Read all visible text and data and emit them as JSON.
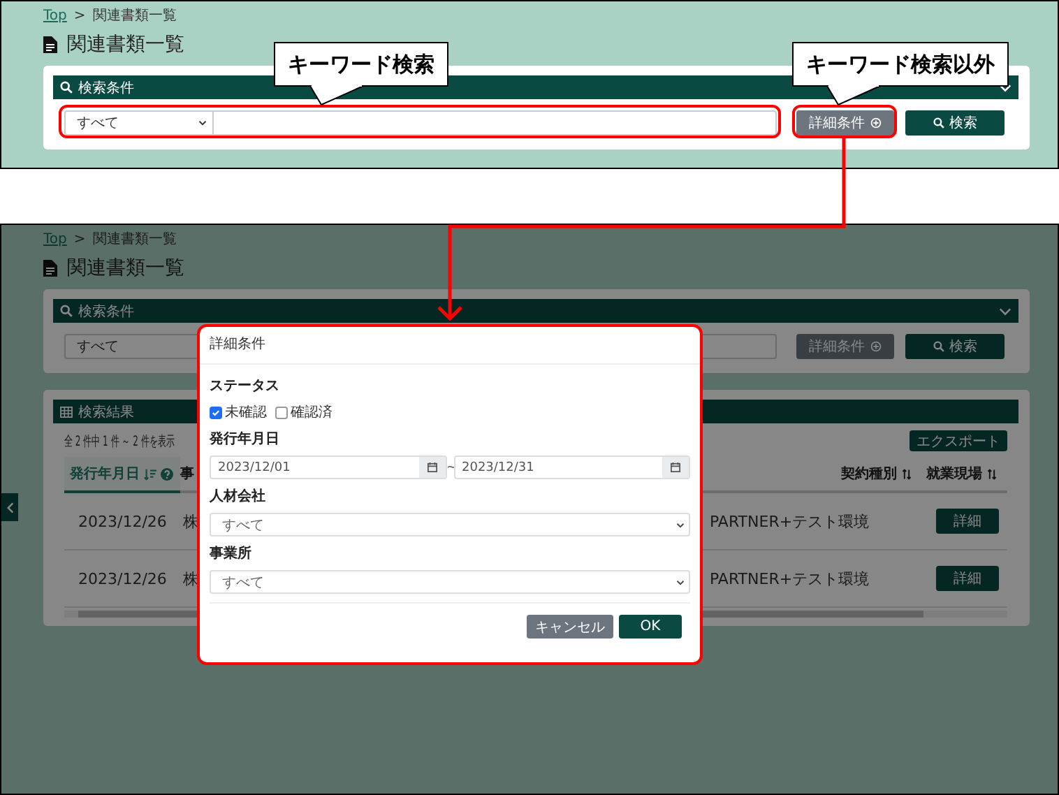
{
  "callouts": [
    {
      "text": "キーワード検索"
    },
    {
      "text": "キーワード検索以外"
    }
  ],
  "screens": [
    {
      "kind": "before",
      "breadcrumb": [
        "Top",
        "関連書類一覧"
      ],
      "breadcrumb_separator": ">",
      "title": "関連書類一覧",
      "search_panel": {
        "title": "検索条件",
        "select_value": "すべて",
        "detail_button": "詳細条件",
        "search_button": "検索"
      }
    },
    {
      "kind": "after",
      "breadcrumb": [
        "Top",
        "関連書類一覧"
      ],
      "breadcrumb_separator": ">",
      "title": "関連書類一覧",
      "search_panel": {
        "title": "検索条件",
        "select_value": "すべて",
        "detail_button": "詳細条件",
        "search_button": "検索"
      },
      "results": {
        "title": "検索結果",
        "count": "全 2 件中 1 件 ～ 2 件を表示",
        "export_button": "エクスポート",
        "columns": [
          {
            "label": "発行年月日",
            "sorted": true,
            "help": true
          },
          {
            "label": "事"
          },
          {
            "label": "契約種別",
            "sorted": false
          },
          {
            "label": "就業現場",
            "sorted": false
          }
        ],
        "rows": [
          {
            "date": "2023/12/26",
            "company": "株",
            "client": "PARTNER+テスト環境",
            "button": "詳細"
          },
          {
            "date": "2023/12/26",
            "company": "株",
            "client": "PARTNER+テスト環境",
            "button": "詳細"
          }
        ]
      }
    }
  ],
  "modal": {
    "title": "詳細条件",
    "status_label": "ステータス",
    "checkboxes": [
      {
        "label": "未確認",
        "checked": true
      },
      {
        "label": "確認済",
        "checked": false
      }
    ],
    "date_label": "発行年月日",
    "date_from": "2023/12/01",
    "separator": "~",
    "date_to": "2023/12/31",
    "company_label": "人材会社",
    "company_value": "すべて",
    "office_label": "事業所",
    "office_value": "すべて",
    "buttons": [
      {
        "label": "キャンセル",
        "kind": "secondary"
      },
      {
        "label": "OK",
        "kind": "primary"
      }
    ]
  }
}
